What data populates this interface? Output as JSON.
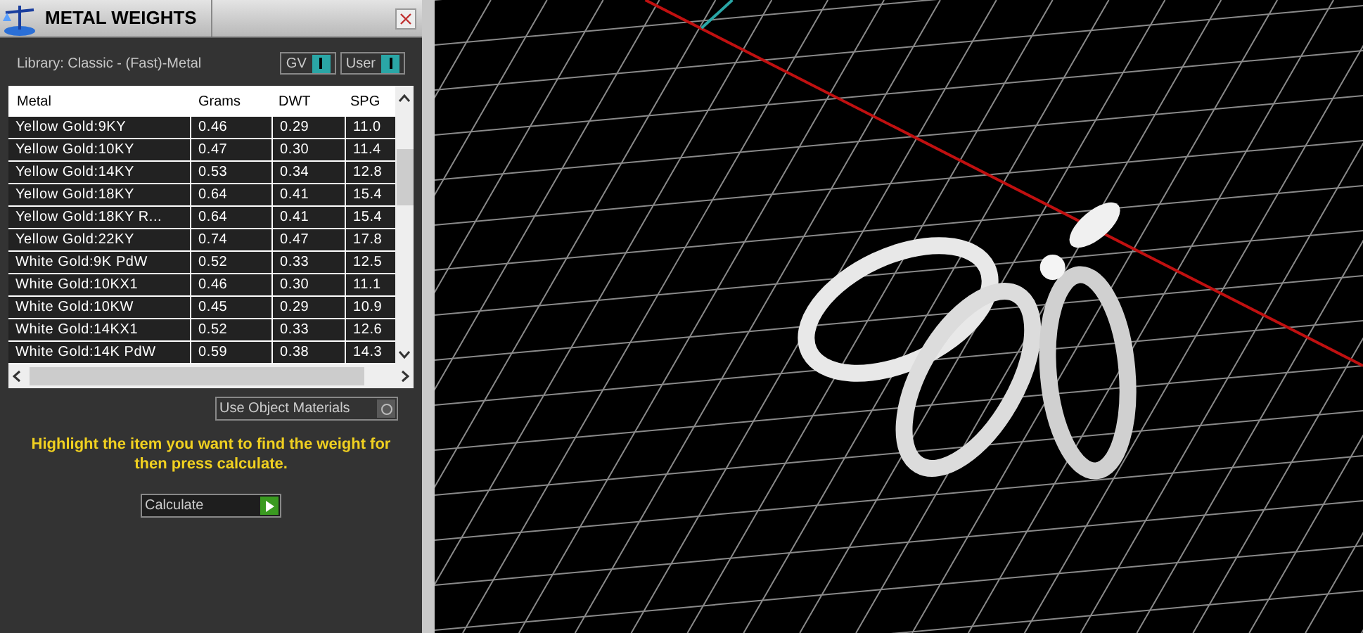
{
  "panel": {
    "title": "METAL WEIGHTS",
    "library": "Library: Classic - (Fast)-Metal",
    "toggles": [
      {
        "label": "GV",
        "on": true
      },
      {
        "label": "User",
        "on": true
      }
    ]
  },
  "table": {
    "columns": [
      "Metal",
      "Grams",
      "DWT",
      "SPG"
    ],
    "rows": [
      [
        "Yellow Gold:9KY",
        "0.46",
        "0.29",
        "11.0"
      ],
      [
        "Yellow Gold:10KY",
        "0.47",
        "0.30",
        "11.4"
      ],
      [
        "Yellow Gold:14KY",
        "0.53",
        "0.34",
        "12.8"
      ],
      [
        "Yellow Gold:18KY",
        "0.64",
        "0.41",
        "15.4"
      ],
      [
        "Yellow Gold:18KY R...",
        "0.64",
        "0.41",
        "15.4"
      ],
      [
        "Yellow Gold:22KY",
        "0.74",
        "0.47",
        "17.8"
      ],
      [
        "White Gold:9K PdW",
        "0.52",
        "0.33",
        "12.5"
      ],
      [
        "White Gold:10KX1",
        "0.46",
        "0.30",
        "11.1"
      ],
      [
        "White Gold:10KW",
        "0.45",
        "0.29",
        "10.9"
      ],
      [
        "White Gold:14KX1",
        "0.52",
        "0.33",
        "12.6"
      ],
      [
        "White Gold:14K PdW",
        "0.59",
        "0.38",
        "14.3"
      ]
    ]
  },
  "use_object_materials": {
    "label": "Use Object Materials",
    "on": false
  },
  "hint": "Highlight the item you want to find the weight for then press calculate.",
  "calculate_button": "Calculate"
}
